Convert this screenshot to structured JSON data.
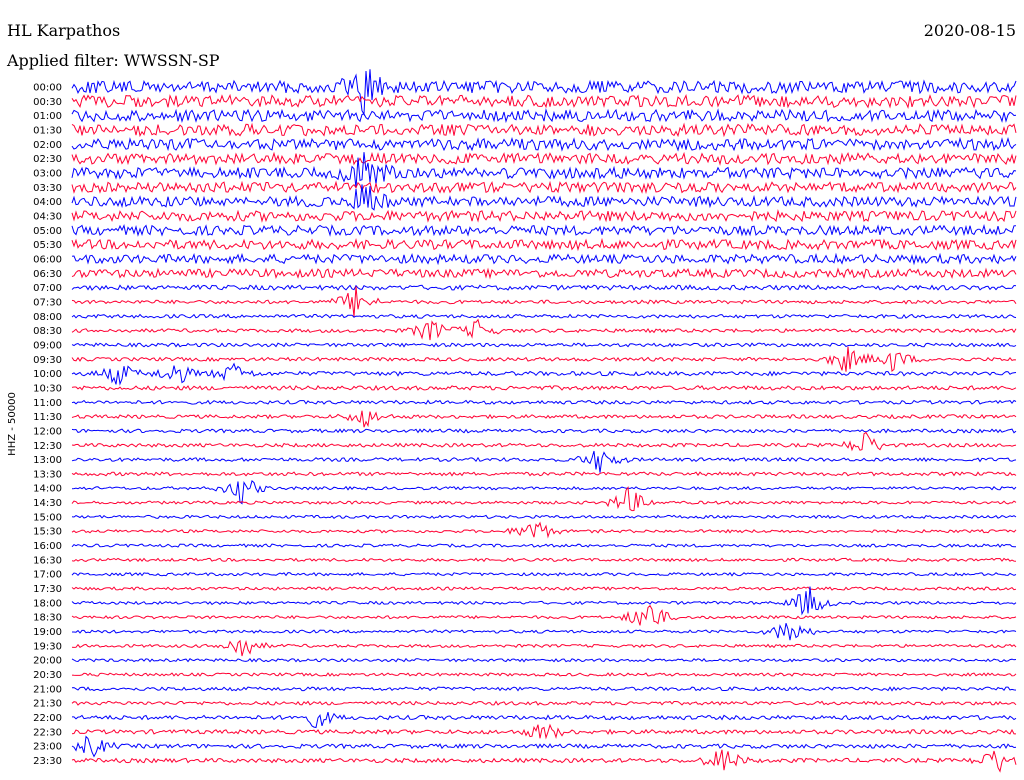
{
  "header": {
    "station": "HL Karpathos",
    "date": "2020-08-15",
    "filter": "Applied filter: WWSSN-SP"
  },
  "chart_data": {
    "type": "line",
    "title": "HL Karpathos",
    "subtitle": "Applied filter: WWSSN-SP",
    "date": "2020-08-15",
    "ylabel": "HHZ - 50000",
    "xlabel": "",
    "grid": false,
    "trace_colors": [
      "#0000ff",
      "#ff0033"
    ],
    "row_labels": [
      "00:00",
      "00:30",
      "01:00",
      "01:30",
      "02:00",
      "02:30",
      "03:00",
      "03:30",
      "04:00",
      "04:30",
      "05:00",
      "05:30",
      "06:00",
      "06:30",
      "07:00",
      "07:30",
      "08:00",
      "08:30",
      "09:00",
      "09:30",
      "10:00",
      "10:30",
      "11:00",
      "11:30",
      "12:00",
      "12:30",
      "13:00",
      "13:30",
      "14:00",
      "14:30",
      "15:00",
      "15:30",
      "16:00",
      "16:30",
      "17:00",
      "17:30",
      "18:00",
      "18:30",
      "19:00",
      "19:30",
      "20:00",
      "20:30",
      "21:00",
      "21:30",
      "22:00",
      "22:30",
      "23:00",
      "23:30"
    ],
    "noise_level": [
      1.0,
      1.0,
      0.95,
      0.95,
      0.95,
      0.9,
      0.9,
      0.85,
      0.85,
      0.85,
      0.8,
      0.8,
      0.75,
      0.7,
      0.4,
      0.3,
      0.3,
      0.3,
      0.3,
      0.3,
      0.35,
      0.35,
      0.3,
      0.3,
      0.3,
      0.3,
      0.3,
      0.3,
      0.25,
      0.25,
      0.25,
      0.25,
      0.25,
      0.25,
      0.25,
      0.25,
      0.25,
      0.25,
      0.25,
      0.25,
      0.25,
      0.25,
      0.3,
      0.3,
      0.35,
      0.35,
      0.35,
      0.35
    ],
    "events": [
      {
        "row": 0,
        "x": 0.31,
        "amp": 1.6
      },
      {
        "row": 6,
        "x": 0.31,
        "amp": 1.3
      },
      {
        "row": 8,
        "x": 0.31,
        "amp": 1.0
      },
      {
        "row": 15,
        "x": 0.3,
        "amp": 0.9
      },
      {
        "row": 17,
        "x": 0.38,
        "amp": 0.7
      },
      {
        "row": 17,
        "x": 0.43,
        "amp": 0.6
      },
      {
        "row": 19,
        "x": 0.82,
        "amp": 0.8
      },
      {
        "row": 19,
        "x": 0.87,
        "amp": 0.7
      },
      {
        "row": 20,
        "x": 0.05,
        "amp": 0.7
      },
      {
        "row": 20,
        "x": 0.11,
        "amp": 0.7
      },
      {
        "row": 20,
        "x": 0.17,
        "amp": 0.6
      },
      {
        "row": 23,
        "x": 0.31,
        "amp": 0.6
      },
      {
        "row": 25,
        "x": 0.84,
        "amp": 0.8
      },
      {
        "row": 26,
        "x": 0.56,
        "amp": 0.8
      },
      {
        "row": 28,
        "x": 0.18,
        "amp": 0.9
      },
      {
        "row": 29,
        "x": 0.59,
        "amp": 0.9
      },
      {
        "row": 31,
        "x": 0.49,
        "amp": 0.8
      },
      {
        "row": 36,
        "x": 0.78,
        "amp": 1.0
      },
      {
        "row": 37,
        "x": 0.61,
        "amp": 1.2
      },
      {
        "row": 38,
        "x": 0.76,
        "amp": 0.9
      },
      {
        "row": 39,
        "x": 0.18,
        "amp": 0.8
      },
      {
        "row": 44,
        "x": 0.26,
        "amp": 0.6
      },
      {
        "row": 45,
        "x": 0.5,
        "amp": 0.6
      },
      {
        "row": 46,
        "x": 0.02,
        "amp": 0.7
      },
      {
        "row": 47,
        "x": 0.69,
        "amp": 0.8
      },
      {
        "row": 47,
        "x": 0.98,
        "amp": 0.8
      }
    ]
  }
}
